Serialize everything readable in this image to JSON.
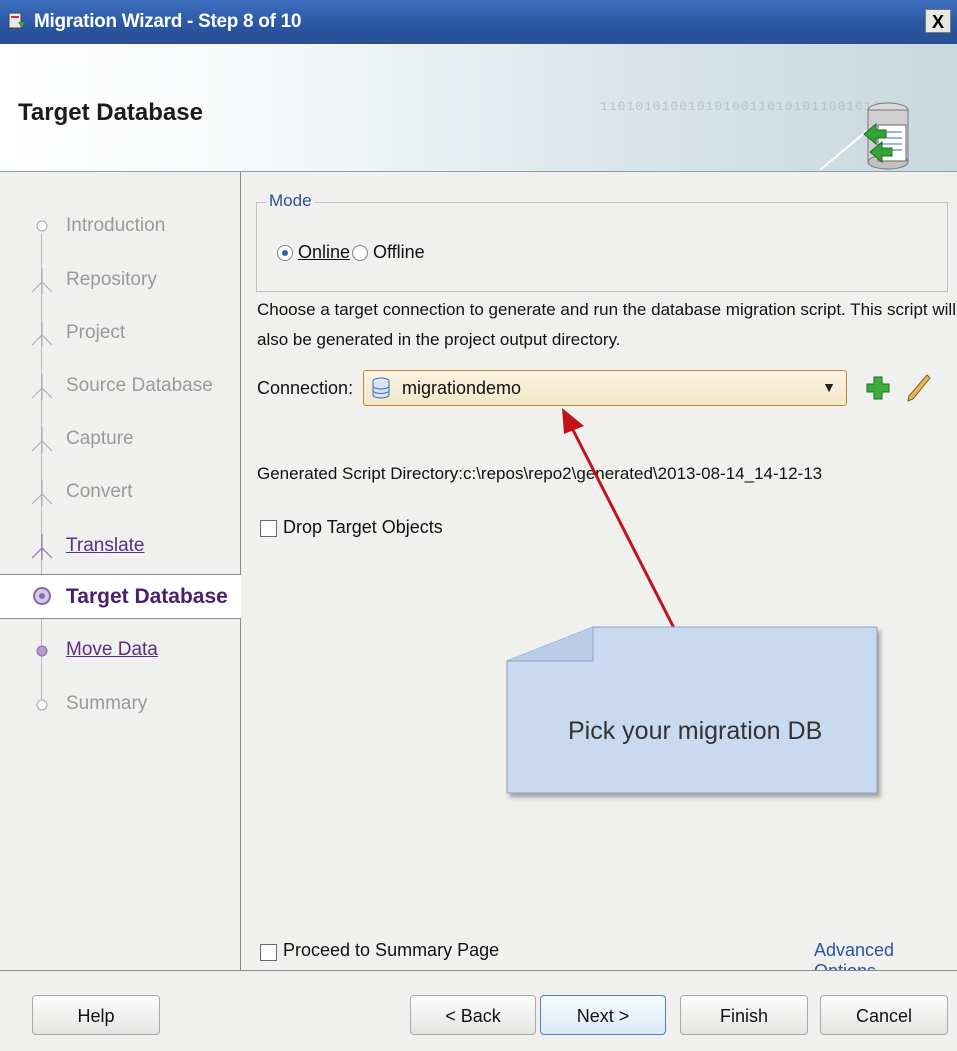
{
  "window": {
    "title": "Migration Wizard - Step 8 of 10",
    "close_label": "X"
  },
  "header": {
    "title": "Target Database",
    "decor_binary": "11010101001010100110101011001010"
  },
  "steps": [
    {
      "label": "Introduction",
      "state": "done"
    },
    {
      "label": "Repository",
      "state": "done"
    },
    {
      "label": "Project",
      "state": "done"
    },
    {
      "label": "Source Database",
      "state": "done"
    },
    {
      "label": "Capture",
      "state": "done"
    },
    {
      "label": "Convert",
      "state": "done"
    },
    {
      "label": "Translate",
      "state": "link"
    },
    {
      "label": "Target Database",
      "state": "active"
    },
    {
      "label": "Move Data",
      "state": "link"
    },
    {
      "label": "Summary",
      "state": "pending"
    }
  ],
  "mode": {
    "legend": "Mode",
    "online_label": "Online",
    "offline_label": "Offline",
    "selected": "Online"
  },
  "description_line1": "Choose a target connection to generate and run the database migration script.  This script will",
  "description_line2": "also be generated in the project output directory.",
  "connection": {
    "label": "Connection:",
    "value": "migrationdemo"
  },
  "script_dir": "Generated Script Directory:c:\\repos\\repo2\\generated\\2013-08-14_14-12-13",
  "drop_target_label": "Drop Target Objects",
  "callout": {
    "text": "Pick your migration DB"
  },
  "proceed_label": "Proceed to Summary Page",
  "advanced_label": "Advanced Options",
  "buttons": {
    "help": "Help",
    "back": "< Back",
    "next": "Next >",
    "finish": "Finish",
    "cancel": "Cancel"
  },
  "colors": {
    "accent": "#2a55a0",
    "link": "#5a2f84",
    "callout_fill": "#c9daf0",
    "arrow": "#c0141a"
  }
}
